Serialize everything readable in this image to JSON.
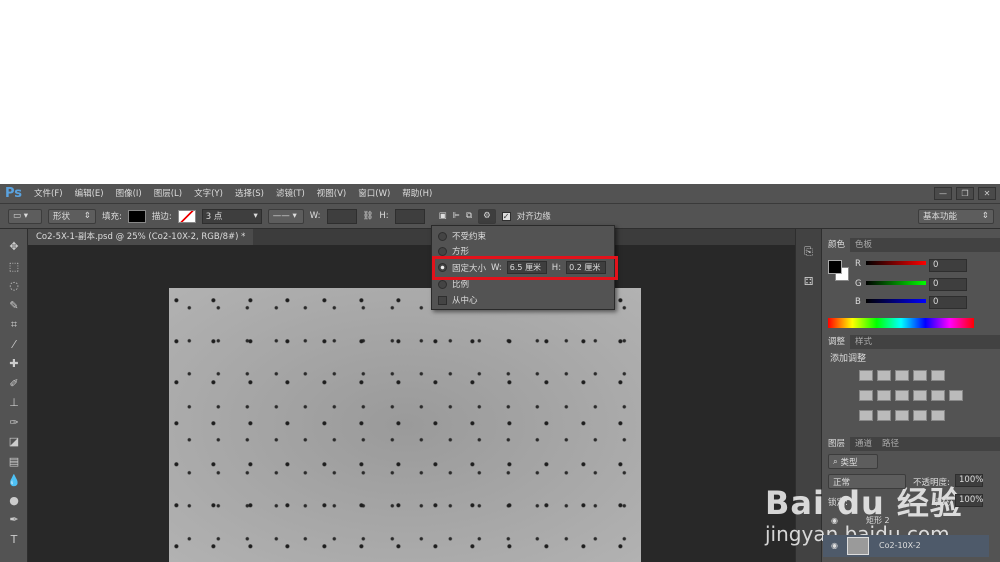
{
  "app": {
    "logo": "Ps",
    "menus": [
      "文件(F)",
      "编辑(E)",
      "图像(I)",
      "图层(L)",
      "文字(Y)",
      "选择(S)",
      "滤镜(T)",
      "视图(V)",
      "窗口(W)",
      "帮助(H)"
    ],
    "window_buttons": [
      "—",
      "❐",
      "✕"
    ]
  },
  "options": {
    "mode": "形状",
    "fill_label": "填充:",
    "stroke_label": "描边:",
    "stroke_size": "3 点",
    "w_label": "W:",
    "h_label": "H:",
    "align_edges": "对齐边缘",
    "align_edges_checked": true,
    "workspace": "基本功能"
  },
  "document": {
    "tab": "Co2-5X-1-副本.psd @ 25% (Co2-10X-2, RGB/8#) *",
    "close": "×"
  },
  "popup": {
    "options": [
      "不受约束",
      "方形",
      "固定大小",
      "比例"
    ],
    "selected": "固定大小",
    "from_center": "从中心",
    "w_label": "W:",
    "h_label": "H:",
    "w_value": "6.5 厘米",
    "h_value": "0.2 厘米",
    "highlight_color": "#e3121b"
  },
  "color_panel": {
    "tabs": [
      "颜色",
      "色板"
    ],
    "channels": [
      {
        "label": "R",
        "value": "0"
      },
      {
        "label": "G",
        "value": "0"
      },
      {
        "label": "B",
        "value": "0"
      }
    ]
  },
  "adjust_panel": {
    "tabs": [
      "调整",
      "样式"
    ],
    "title": "添加调整"
  },
  "layers_panel": {
    "tabs": [
      "图层",
      "通道",
      "路径"
    ],
    "filter": "类型",
    "blend": "正常",
    "opacity_label": "不透明度:",
    "opacity": "100%",
    "lock_label": "锁定:",
    "fill_label": "填充:",
    "fill": "100%",
    "layers": [
      {
        "name": "矩形 2",
        "selected": false
      },
      {
        "name": "Co2-10X-2",
        "selected": true
      }
    ]
  },
  "watermark": {
    "brand": "Bai du 经验",
    "url": "jingyan.baidu.com"
  }
}
